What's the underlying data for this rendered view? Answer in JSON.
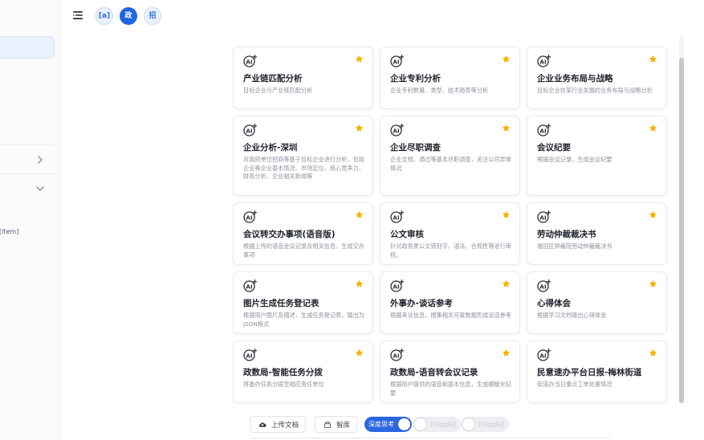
{
  "sidebar": {
    "cut_text": "[item]"
  },
  "topbar": {
    "badges": [
      {
        "label": "[a]",
        "active": false
      },
      {
        "label": "政",
        "active": true
      },
      {
        "label": "招",
        "active": false
      }
    ]
  },
  "cards": [
    {
      "title": "产业链匹配分析",
      "desc": "目标企业与产业链匹配分析",
      "starred": true
    },
    {
      "title": "企业专利分析",
      "desc": "企业专利数量、类型、技术趋势等分析",
      "starred": true
    },
    {
      "title": "企业业务布局与战略",
      "desc": "目标企业在某行业发展的业务布局与战略分析",
      "starred": true
    },
    {
      "title": "企业分析-深圳",
      "desc": "对政府单位招商等基于目标企业进行分析，包括企业等企业基本情况、市场定位、核心竞争力、财务分析、企业相关新闻等",
      "starred": true
    },
    {
      "title": "企业尽职调查",
      "desc": "企业文档、通过等基本尽职调查，关注公司异常情况",
      "starred": true
    },
    {
      "title": "会议纪要",
      "desc": "根据会议记录，生成会议纪要",
      "starred": true
    },
    {
      "title": "会议转交办事项(语音版)",
      "desc": "根据上传的语音会议记录及相关信息，生成交办事项",
      "starred": true
    },
    {
      "title": "公文审核",
      "desc": "针对政务类公文错别字、语法、合规性等进行审核。",
      "starred": true
    },
    {
      "title": "劳动仲裁裁决书",
      "desc": "福田区仲裁院劳动仲裁裁决书",
      "starred": true
    },
    {
      "title": "图片生成任务登记表",
      "desc": "根据用户图片及描述，生成任务登记表，输出为JSON格式",
      "starred": true
    },
    {
      "title": "外事办-谈话参考",
      "desc": "根据来访信息，搜集相关可靠数据形成谈话参考",
      "starred": true
    },
    {
      "title": "心得体会",
      "desc": "根据学习文档输出心得体会",
      "starred": true
    },
    {
      "title": "政数局-智能任务分拨",
      "desc": "将备办任务分拨至相应责任单位",
      "starred": true
    },
    {
      "title": "政数局-语音转会议记录",
      "desc": "根据用户提供的语音和基本信息，生成模版化纪要",
      "starred": true
    },
    {
      "title": "民意速办平台日报-梅林街道",
      "desc": "街道办当日重点工单处置情况",
      "starred": true
    }
  ],
  "toolbar": {
    "upload_label": "上传文档",
    "kb_label": "智库",
    "toggles": [
      {
        "label": "深度思考",
        "on": true
      },
      {
        "label": "[toggle]",
        "on": false
      },
      {
        "label": "[toggle]",
        "on": false
      }
    ]
  },
  "colors": {
    "accent": "#1f65e3",
    "star": "#f4b400",
    "card_border": "#e8eaef",
    "desc_text": "#8c929c"
  }
}
